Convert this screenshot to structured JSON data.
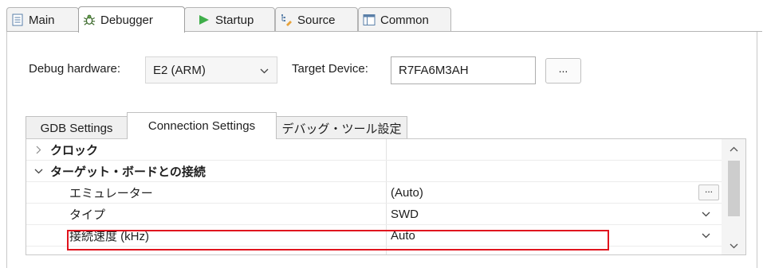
{
  "tabs": [
    {
      "label": "Main",
      "icon": "main-tab-icon"
    },
    {
      "label": "Debugger",
      "icon": "debugger-bug-icon"
    },
    {
      "label": "Startup",
      "icon": "startup-play-icon"
    },
    {
      "label": "Source",
      "icon": "source-lookup-icon"
    },
    {
      "label": "Common",
      "icon": "common-tab-icon"
    }
  ],
  "form": {
    "debug_hardware_label": "Debug hardware:",
    "debug_hardware_value": "E2 (ARM)",
    "target_device_label": "Target Device:",
    "target_device_value": "R7FA6M3AH",
    "browse_label": "..."
  },
  "inner_tabs": [
    {
      "label": "GDB Settings"
    },
    {
      "label": "Connection Settings"
    },
    {
      "label": "デバッグ・ツール設定"
    }
  ],
  "properties": {
    "groups": [
      {
        "name": "クロック",
        "expanded": false
      },
      {
        "name": "ターゲット・ボードとの接続",
        "expanded": true
      }
    ],
    "rows": [
      {
        "name": "エミュレーター",
        "value": "(Auto)",
        "control": "..."
      },
      {
        "name": "タイプ",
        "value": "SWD"
      },
      {
        "name": "接続速度 (kHz)",
        "value": "Auto"
      }
    ]
  },
  "colors": {
    "highlight": "#e0141e"
  }
}
